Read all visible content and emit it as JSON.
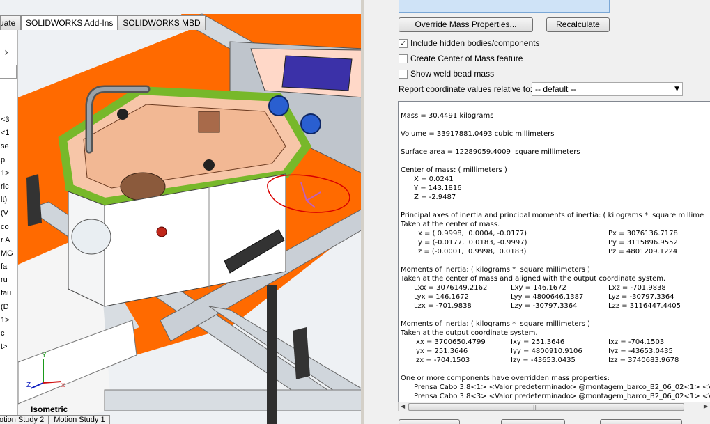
{
  "cad": {
    "tabs": [
      "uate",
      "SOLIDWORKS Add-Ins",
      "SOLIDWORKS MBD"
    ],
    "active_tab_index": 1,
    "feature_tree_rows": [
      "<3",
      "<1",
      "se",
      "p",
      "1>",
      "ric",
      "lt)",
      "(V",
      "co",
      "r A",
      "MG",
      "fa",
      "ru",
      "fau",
      "(D",
      "1>",
      "c",
      "t>"
    ],
    "view_orientation": "Isometric",
    "bottom_tabs": [
      "otion Study 2",
      "Motion Study 1"
    ],
    "triad": {
      "x_label": "x",
      "y_label": "Y",
      "z_label": "Z"
    },
    "colors": {
      "orange": "#ff6a00",
      "green": "#7fbf2a",
      "steel": "#d7dde3"
    }
  },
  "panel": {
    "override_button": "Override Mass Properties...",
    "recalculate_button": "Recalculate",
    "checkboxes": [
      {
        "label": "Include hidden bodies/components",
        "checked": true
      },
      {
        "label": "Create Center of Mass feature",
        "checked": false
      },
      {
        "label": "Show weld bead mass",
        "checked": false
      }
    ],
    "report_label": "Report coordinate values relative to:",
    "report_value": "-- default --",
    "results": {
      "mass": "Mass = 30.4491 kilograms",
      "volume": "Volume = 33917881.0493 cubic millimeters",
      "surface_area": "Surface area = 12289059.4009  square millimeters",
      "com_header": "Center of mass: ( millimeters )",
      "com_x": "X = 0.0241",
      "com_y": "Y = 143.1816",
      "com_z": "Z = -2.9487",
      "principal_header": "Principal axes of inertia and principal moments of inertia: ( kilograms *  square millime",
      "taken_at_com": "Taken at the center of mass.",
      "ix": "Ix = ( 0.9998,  0.0004, -0.0177)",
      "iy": "Iy = (-0.0177,  0.0183, -0.9997)",
      "iz": "Iz = (-0.0001,  0.9998,  0.0183)",
      "px": "Px = 3076136.7178",
      "py": "Py = 3115896.9552",
      "pz": "Pz = 4801209.1224",
      "moi_header_1": "Moments of inertia: ( kilograms *  square millimeters )",
      "moi_taken_1": "Taken at the center of mass and aligned with the output coordinate system.",
      "lxx": "Lxx = 3076149.2162",
      "lxy": "Lxy = 146.1672",
      "lxz": "Lxz = -701.9838",
      "lyx": "Lyx = 146.1672",
      "lyy": "Lyy = 4800646.1387",
      "lyz": "Lyz = -30797.3364",
      "lzx": "Lzx = -701.9838",
      "lzy": "Lzy = -30797.3364",
      "lzz": "Lzz = 3116447.4405",
      "moi_header_2": "Moments of inertia: ( kilograms *  square millimeters )",
      "moi_taken_2": "Taken at the output coordinate system.",
      "ixx": "Ixx = 3700650.4799",
      "ixy": "Ixy = 251.3646",
      "ixz": "Ixz = -704.1503",
      "iyx": "Iyx = 251.3646",
      "iyy": "Iyy = 4800910.9106",
      "iyz": "Iyz = -43653.0435",
      "izx": "Izx = -704.1503",
      "izy": "Izy = -43653.0435",
      "izz": "Izz = 3740683.9678",
      "override_note": "One or more components have overridden mass properties:",
      "override_1": "Prensa Cabo 3.8<1> <Valor predeterminado> @montagem_barco_B2_06_02<1> <V",
      "override_2": "Prensa Cabo 3.8<3> <Valor predeterminado> @montagem_barco_B2_06_02<1> <V"
    }
  }
}
